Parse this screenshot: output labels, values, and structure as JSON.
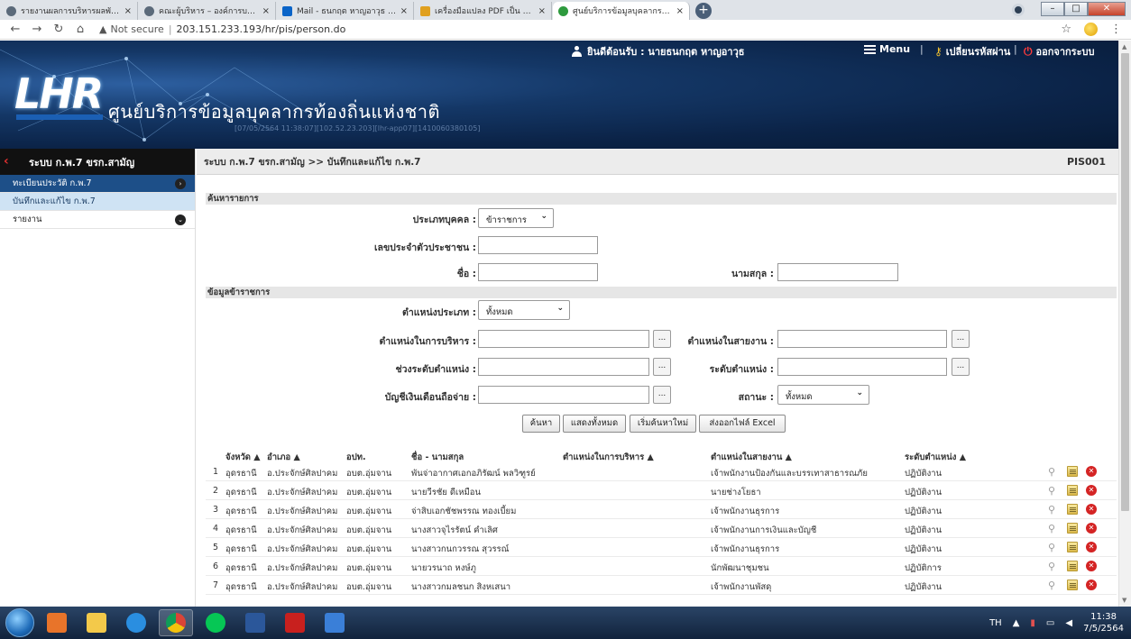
{
  "browser": {
    "tabs": [
      {
        "title": "รายงานผลการบริหารผลพัฒนาทรัพยา",
        "color": "#5b6a7a"
      },
      {
        "title": "คณะผู้บริหาร – องค์การบริหารส่วนตำบ",
        "color": "#5b6a7a"
      },
      {
        "title": "Mail - ธนกฤต หาญอาวุธ - Outlook",
        "color": "#0a64c8"
      },
      {
        "title": "เครื่องมือแปลง PDF เป็น Word - ฟรี",
        "color": "#e0a020"
      },
      {
        "title": "ศูนย์บริการข้อมูลบุคลากรท้องถิ่นแห่งช",
        "color": "#2e9a3e"
      }
    ],
    "tab_close": "×",
    "new_tab": "+",
    "not_secure": "Not secure",
    "separator": "|",
    "url": "203.151.233.193/hr/pis/person.do"
  },
  "header": {
    "logo": "LHR",
    "title": "ศูนย์บริการข้อมูลบุคลากรท้องถิ่นแห่งชาติ",
    "session_info": "[07/05/2564 11:38:07][102.52.23.203][lhr-app07][1410060380105]",
    "welcome": "ยินดีต้อนรับ : นายธนกฤต หาญอาวุธ",
    "menu": "Menu",
    "change_password": "เปลี่ยนรหัสผ่าน",
    "logout": "ออกจากระบบ",
    "menu_separator": "|"
  },
  "sidebar": {
    "header": "ระบบ ก.พ.7 ขรก.สามัญ",
    "items": [
      {
        "label": "ทะเบียนประวัติ ก.พ.7",
        "state": "active"
      },
      {
        "label": "บันทึกและแก้ไข ก.พ.7",
        "state": "sub"
      },
      {
        "label": "รายงาน",
        "state": "normal"
      }
    ]
  },
  "main": {
    "breadcrumb": "ระบบ ก.พ.7 ขรก.สามัญ >> บันทึกและแก้ไข ก.พ.7",
    "page_code": "PIS001",
    "search_section": "ค้นหารายการ",
    "officer_section": "ข้อมูลข้าราชการ",
    "form": {
      "person_type_label": "ประเภทบุคคล :",
      "person_type_value": "ข้าราชการ",
      "citizen_id_label": "เลขประจำตัวประชาชน :",
      "first_name_label": "ชื่อ :",
      "last_name_label": "นามสกุล :",
      "position_type_label": "ตำแหน่งประเภท :",
      "position_type_value": "ทั้งหมด",
      "admin_position_label": "ตำแหน่งในการบริหาร :",
      "line_position_label": "ตำแหน่งในสายงาน :",
      "level_range_label": "ช่วงระดับตำแหน่ง :",
      "level_label": "ระดับตำแหน่ง :",
      "salary_account_label": "บัญชีเงินเดือนถือจ่าย :",
      "status_label": "สถานะ :",
      "status_value": "ทั้งหมด",
      "picker": "...",
      "dropdown": "⌄"
    },
    "actions": {
      "search": "ค้นหา",
      "show_all": "แสดงทั้งหมด",
      "reset": "เริ่มค้นหาใหม่",
      "export": "ส่งออกไฟล์ Excel"
    },
    "table": {
      "columns": [
        "จังหวัด ▲",
        "อำเภอ ▲",
        "อปท.",
        "ชื่อ - นามสกุล",
        "ตำแหน่งในการบริหาร ▲",
        "ตำแหน่งในสายงาน ▲",
        "ระดับตำแหน่ง ▲"
      ],
      "rows": [
        {
          "no": "1",
          "province": "อุดรธานี",
          "district": "อ.ประจักษ์ศิลปาคม",
          "org": "อบต.อุ่มจาน",
          "name": "พันจ่าอากาศเอกอภิรัฒน์ พลวิฑูรย์",
          "admin": "",
          "line": "เจ้าพนักงานป้องกันและบรรเทาสาธารณภัย",
          "level": "ปฏิบัติงาน"
        },
        {
          "no": "2",
          "province": "อุดรธานี",
          "district": "อ.ประจักษ์ศิลปาคม",
          "org": "อบต.อุ่มจาน",
          "name": "นายวีรชัย ดีเหมือน",
          "admin": "",
          "line": "นายช่างโยธา",
          "level": "ปฏิบัติงาน"
        },
        {
          "no": "3",
          "province": "อุดรธานี",
          "district": "อ.ประจักษ์ศิลปาคม",
          "org": "อบต.อุ่มจาน",
          "name": "จ่าสิบเอกชัชพรรณ ทองเบี้ยม",
          "admin": "",
          "line": "เจ้าพนักงานธุรการ",
          "level": "ปฏิบัติงาน"
        },
        {
          "no": "4",
          "province": "อุดรธานี",
          "district": "อ.ประจักษ์ศิลปาคม",
          "org": "อบต.อุ่มจาน",
          "name": "นางสาวจุไรรัตน์ คำเลิศ",
          "admin": "",
          "line": "เจ้าพนักงานการเงินและบัญชี",
          "level": "ปฏิบัติงาน"
        },
        {
          "no": "5",
          "province": "อุดรธานี",
          "district": "อ.ประจักษ์ศิลปาคม",
          "org": "อบต.อุ่มจาน",
          "name": "นางสาวกนกวรรณ สุวรรณ์",
          "admin": "",
          "line": "เจ้าพนักงานธุรการ",
          "level": "ปฏิบัติงาน"
        },
        {
          "no": "6",
          "province": "อุดรธานี",
          "district": "อ.ประจักษ์ศิลปาคม",
          "org": "อบต.อุ่มจาน",
          "name": "นายวรนาถ หงษ์ภู",
          "admin": "",
          "line": "นักพัฒนาชุมชน",
          "level": "ปฏิบัติการ"
        },
        {
          "no": "7",
          "province": "อุดรธานี",
          "district": "อ.ประจักษ์ศิลปาคม",
          "org": "อบต.อุ่มจาน",
          "name": "นางสาวกมลชนก สิงหเสนา",
          "admin": "",
          "line": "เจ้าพนักงานพัสดุ",
          "level": "ปฏิบัติงาน"
        }
      ]
    }
  },
  "taskbar": {
    "lang": "TH",
    "time": "11:38",
    "date": "7/5/2564"
  },
  "colors": {
    "active_sidebar": "#1d4f88",
    "sub_sidebar": "#cfe3f4",
    "banner": "#0b2347",
    "delete": "#d42424"
  }
}
